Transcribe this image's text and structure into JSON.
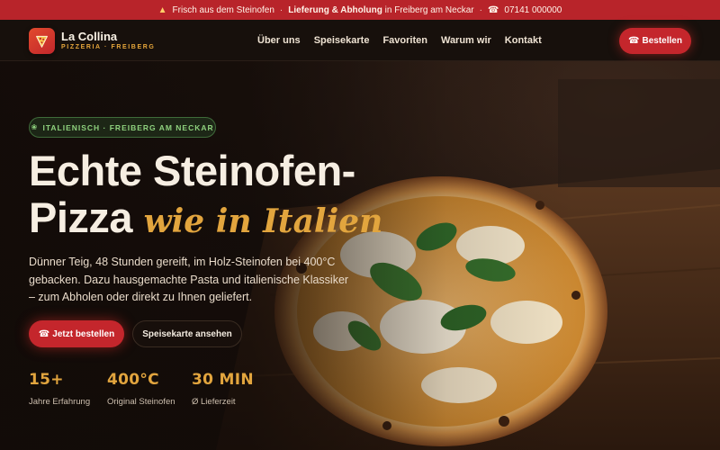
{
  "topbar": {
    "item1": "Frisch aus dem Steinofen",
    "item2_bold": "Lieferung & Abholung",
    "item2_rest": "in Freiberg am Neckar",
    "phone": "07141 000000"
  },
  "brand": {
    "name": "La Collina",
    "subtitle": "PIZZERIA · FREIBERG"
  },
  "nav": {
    "links": [
      "Über uns",
      "Speisekarte",
      "Favoriten",
      "Warum wir",
      "Kontakt"
    ],
    "cta": "Bestellen"
  },
  "hero": {
    "tag": "ITALIENISCH · FREIBERG AM NECKAR",
    "headline_line1": "Echte Steinofen-",
    "headline_line2": "Pizza",
    "headline_accent": "wie in Italien",
    "lead": "Dünner Teig, 48 Stunden gereift, im Holz-Steinofen bei 400°C gebacken. Dazu hausgemachte Pasta und italienische Klassiker – zum Abholen oder direkt zu Ihnen geliefert.",
    "primary_cta": "Jetzt bestellen",
    "secondary_cta": "Speisekarte ansehen"
  },
  "stats": [
    {
      "value": "15+",
      "label": "Jahre Erfahrung"
    },
    {
      "value": "400°C",
      "label": "Original Steinofen"
    },
    {
      "value": "30 MIN",
      "label": "Ø Lieferzeit"
    }
  ],
  "icons": {
    "flame": "flame-icon",
    "phone": "phone-icon",
    "pizza_logo": "pizza-slice-icon",
    "leaf": "leaf-icon"
  },
  "colors": {
    "brand_red": "#c4262c",
    "accent_gold": "#e2a53e",
    "tag_green": "#8fd27e",
    "background": "#140d09"
  }
}
